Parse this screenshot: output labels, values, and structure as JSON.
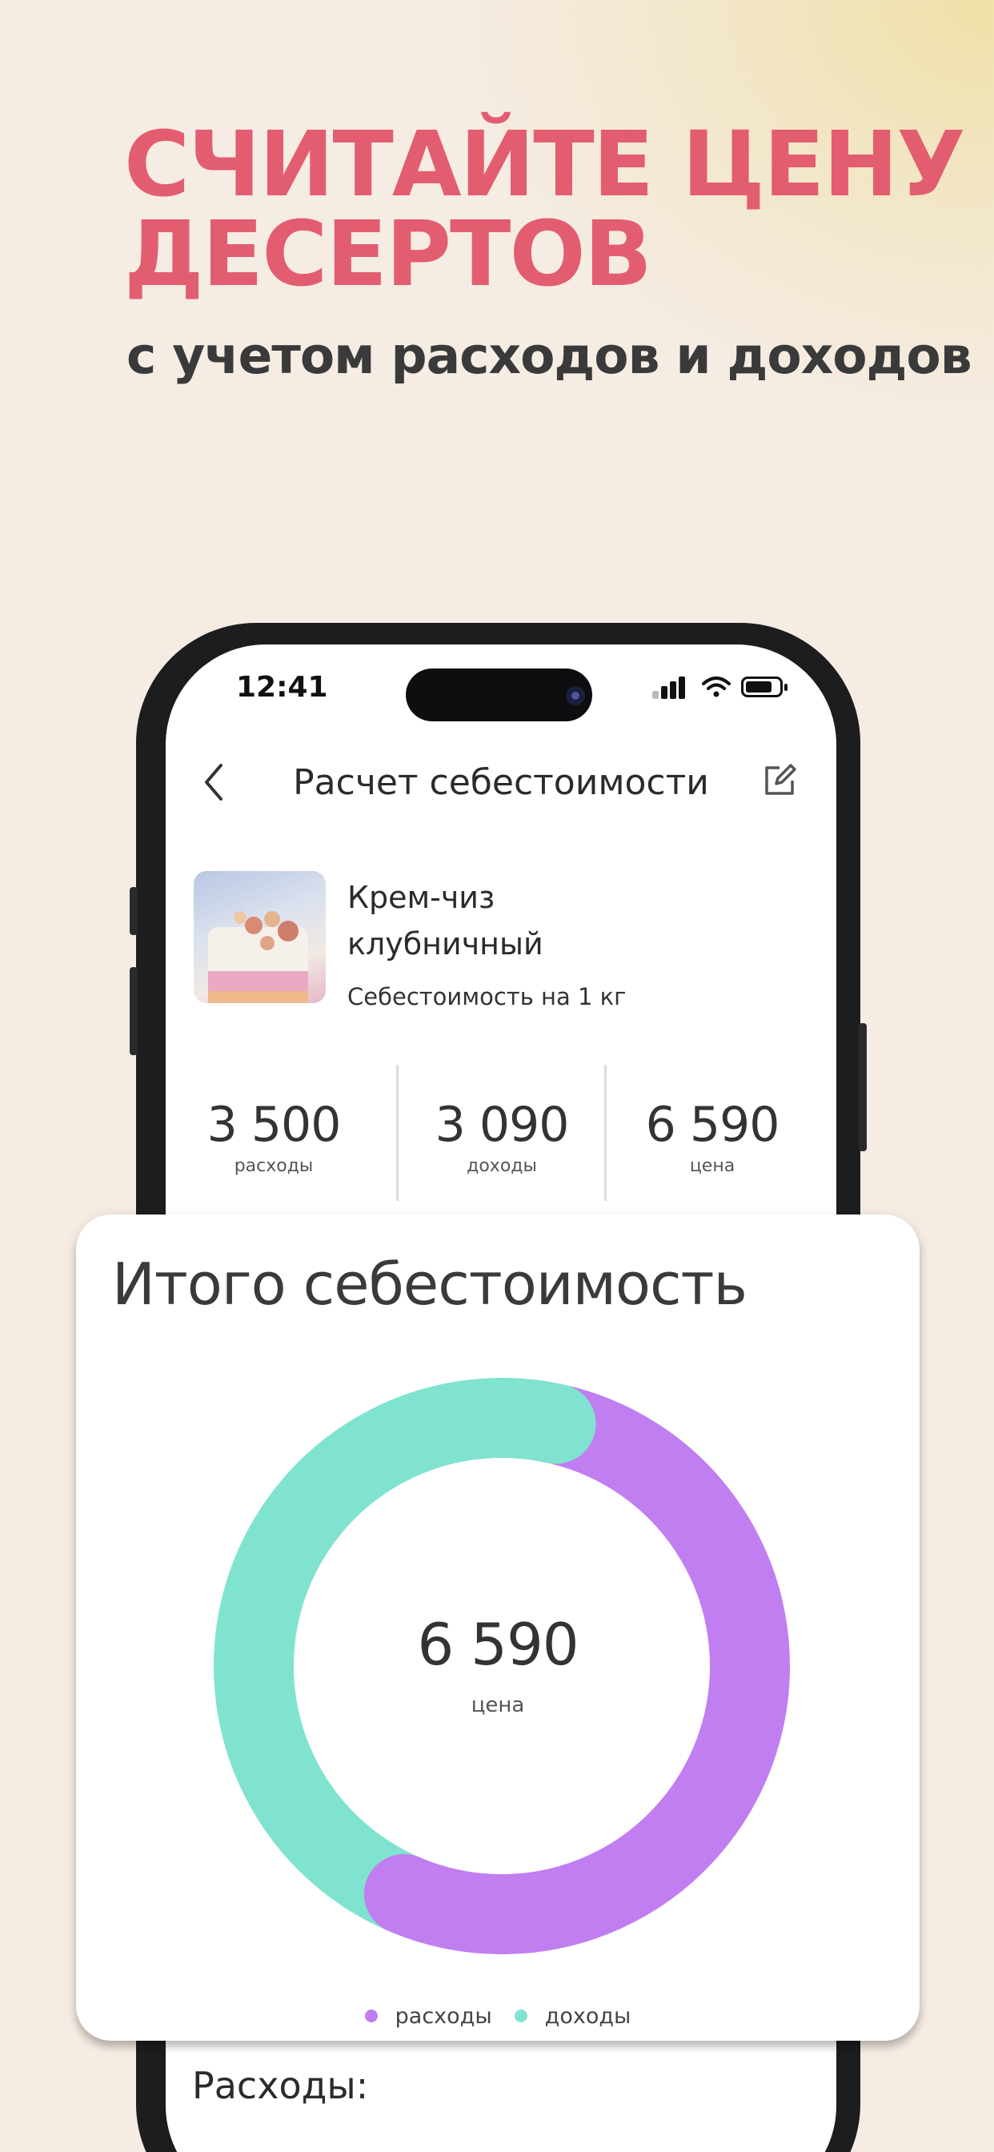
{
  "promo": {
    "headline": "СЧИТАЙТЕ ЦЕНУ ДЕСЕРТОВ",
    "subline": "с учетом расходов и доходов"
  },
  "status_bar": {
    "time": "12:41"
  },
  "nav": {
    "title": "Расчет себестоимости",
    "back_icon": "chevron-left-icon",
    "edit_icon": "edit-icon"
  },
  "product": {
    "name": "Крем-чиз клубничный",
    "subtitle": "Себестоимость на 1 кг"
  },
  "stats": [
    {
      "value": "3 500",
      "label": "расходы"
    },
    {
      "value": "3 090",
      "label": "доходы"
    },
    {
      "value": "6 590",
      "label": "цена"
    }
  ],
  "summary_card": {
    "title": "Итого себестоимость",
    "center_value": "6 590",
    "center_label": "цена"
  },
  "chart_data": {
    "type": "pie",
    "donut": true,
    "categories": [
      "расходы",
      "доходы"
    ],
    "values": [
      3500,
      3090
    ],
    "colors": [
      "#c17ef0",
      "#80e3cf"
    ],
    "legend_position": "bottom"
  },
  "section": {
    "expenses_title": "Расходы:"
  }
}
